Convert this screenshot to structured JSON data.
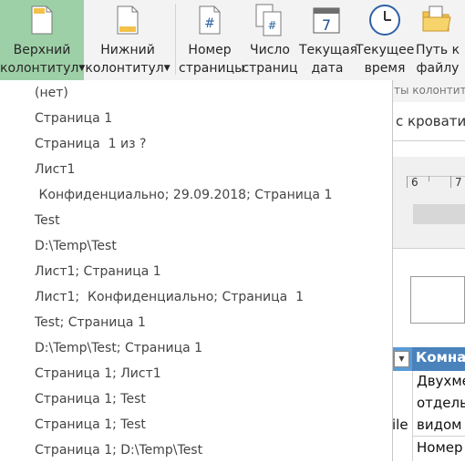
{
  "ribbon": {
    "header_button": {
      "line1": "Верхний",
      "line2": "колонтитул"
    },
    "footer_button": {
      "line1": "Нижний",
      "line2": "колонтитул"
    },
    "page_number_button": {
      "line1": "Номер",
      "line2": "страницы"
    },
    "page_count_button": {
      "line1": "Число",
      "line2": "страниц"
    },
    "current_date_button": {
      "line1": "Текущая",
      "line2": "дата"
    },
    "current_time_button": {
      "line1": "Текущее",
      "line2": "время"
    },
    "file_path_button": {
      "line1": "Путь к",
      "line2": "файлу"
    },
    "date_icon_digit": "7",
    "group_label": "ты колонтит..."
  },
  "header_menu": {
    "items": [
      "(нет)",
      "Страница 1",
      "Страница  1 из ?",
      "Лист1",
      " Конфиденциально; 29.09.2018; Страница 1",
      "Test",
      "D:\\Temp\\Test",
      "Лист1; Страница 1",
      "Лист1;  Конфиденциально; Страница  1",
      "Test; Страница 1",
      "D:\\Temp\\Test; Страница 1",
      "Страница 1; Лист1",
      "Страница 1; Test",
      "Страница 1; Test",
      "Страница 1; D:\\Temp\\Test"
    ]
  },
  "sheet": {
    "tab_title": "с кровати",
    "ruler": {
      "n6": "6",
      "n7": "7"
    },
    "column_header": "Комнат",
    "cells": [
      "Двухме",
      "отдель",
      "видом",
      "Номер"
    ],
    "left_cell_fragment": "ile"
  },
  "colors": {
    "ribbon_bg": "#f3f3f3",
    "selected_button": "#9ed0a7",
    "table_header_blue": "#4a82bc",
    "table_header_blue_light": "#5b9bd5"
  }
}
